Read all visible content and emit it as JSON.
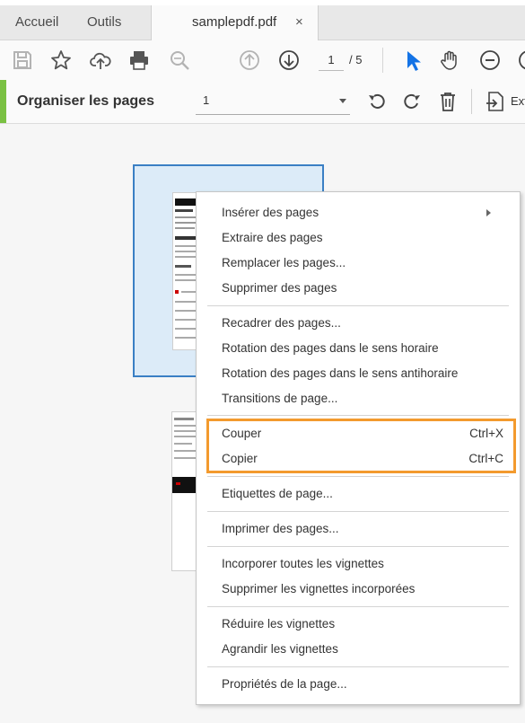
{
  "tabs": {
    "home": "Accueil",
    "tools": "Outils",
    "document": "samplepdf.pdf",
    "close": "×"
  },
  "toolbar": {
    "current_page": "1",
    "total_pages": "/ 5"
  },
  "organize": {
    "title": "Organiser les pages",
    "page_select": "1",
    "extract_label": "Ext"
  },
  "menu": {
    "insert": "Insérer des pages",
    "extract": "Extraire des pages",
    "replace": "Remplacer les pages...",
    "delete": "Supprimer des pages",
    "crop": "Recadrer des pages...",
    "rotate_cw": "Rotation des pages dans le sens horaire",
    "rotate_ccw": "Rotation des pages dans le sens antihoraire",
    "transitions": "Transitions de page...",
    "cut": "Couper",
    "cut_shortcut": "Ctrl+X",
    "copy": "Copier",
    "copy_shortcut": "Ctrl+C",
    "labels": "Etiquettes de page...",
    "print": "Imprimer des pages...",
    "embed_thumbs": "Incorporer toutes les vignettes",
    "remove_thumbs": "Supprimer les vignettes incorporées",
    "shrink_thumbs": "Réduire les vignettes",
    "enlarge_thumbs": "Agrandir les vignettes",
    "page_props": "Propriétés de la page..."
  },
  "colors": {
    "accent_green": "#7ac143",
    "selection_blue": "#3a7fc4",
    "highlight_orange": "#f39a2e",
    "cursor_blue": "#1473e6"
  }
}
